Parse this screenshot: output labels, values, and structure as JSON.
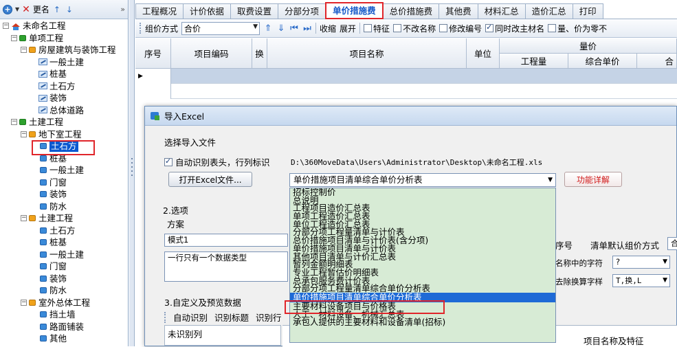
{
  "left_toolbar": {
    "add_icon": "+",
    "delete_icon": "✕",
    "rename_label": "更名",
    "up_icon": "↑",
    "down_icon": "↓",
    "more_icon": "»"
  },
  "tree": {
    "root": "未命名工程",
    "n1": "单项工程",
    "n1_1": "房屋建筑与装饰工程",
    "n1_1_a": "一般土建",
    "n1_1_b": "桩基",
    "n1_1_c": "土石方",
    "n1_1_d": "装饰",
    "n1_1_e": "总体道路",
    "n2": "土建工程",
    "n2_1": "地下室工程",
    "n2_1_a": "土石方",
    "n2_1_b": "桩基",
    "n2_1_c": "一般土建",
    "n2_1_d": "门窗",
    "n2_1_e": "装饰",
    "n2_1_f": "防水",
    "n2_2": "土建工程",
    "n2_2_a": "土石方",
    "n2_2_b": "桩基",
    "n2_2_c": "一般土建",
    "n2_2_d": "门窗",
    "n2_2_e": "装饰",
    "n2_2_f": "防水",
    "n2_3": "室外总体工程",
    "n2_3_a": "挡土墙",
    "n2_3_b": "路面铺装",
    "n2_3_c": "其他"
  },
  "tabs": [
    "工程概况",
    "计价依据",
    "取费设置",
    "分部分项",
    "单价措施费",
    "总价措施费",
    "其他费",
    "材料汇总",
    "造价汇总",
    "打印"
  ],
  "toolbar2": {
    "pricing_method_label": "组价方式",
    "pricing_method_value": "合价",
    "collapse": "收缩",
    "expand": "展开",
    "feature": "特征",
    "no_change_mainmat": "不改名称",
    "modify_code": "修改编号",
    "change_mainmat": "同时改主材名",
    "qty_price_zero": "量、价为零不"
  },
  "grid": {
    "col_seq": "序号",
    "col_code": "项目编码",
    "col_swap": "换",
    "col_name": "项目名称",
    "col_unit": "单位",
    "col_price_group": "量价",
    "col_qty": "工程量",
    "col_unit_price": "综合单价",
    "col_more": "合"
  },
  "dialog": {
    "title": "导入Excel",
    "select_file": "选择导入文件",
    "auto_detect": "自动识别表头，行列标识",
    "file_path": "D:\\360MoveData\\Users\\Administrator\\Desktop\\未命名工程.xls",
    "open_excel_btn": "打开Excel文件...",
    "sheet_selected": "单价措施项目清单综合单价分析表",
    "func_detail_btn": "功能详解",
    "options_title": "2.选项",
    "scheme_label": "方案",
    "scheme_value": "模式1",
    "scheme_desc": "一行只有一个数据类型",
    "preview_title": "3.自定义及预览数据",
    "auto_recognize": "自动识别",
    "recognize_title": "识别标题",
    "recognize_row": "识别行",
    "unrecognized_col": "未识别列",
    "seq_label": "序号",
    "default_pricing_label": "清单默认组价方式",
    "default_pricing_value": "合",
    "name_chars_label": "名称中的字符",
    "name_chars_value": "?",
    "remove_chars_label": "去除换算字样",
    "remove_chars_value": "T,换,L",
    "col_header_name_feature": "项目名称及特征"
  },
  "dropdown_items": [
    "招标控制价",
    "总说明",
    "工程项目造价汇总表",
    "单项工程造价汇总表",
    "单位工程造价汇总表",
    "分部分项工程量清单与计价表",
    "总价措施项目清单与计价表(含分项)",
    "单价措施项目清单与计价表",
    "其他项目清单与计价汇总表",
    "暂列金额明细表",
    "专业工程暂估价明细表",
    "总承包服务费计价表",
    "分部分项工程量清单综合单价分析表",
    "单价措施项目清单综合单价分析表",
    "主要材料设备项目与价格表",
    "人工、材料设备、机械汇总表",
    "承包人提供的主要材料和设备清单(招标)"
  ],
  "colors": {
    "highlight_red": "#e0252a",
    "selection_blue": "#1e6ad6",
    "dropdown_bg": "#d7ebd5",
    "active_tab_text": "#1558c8"
  }
}
